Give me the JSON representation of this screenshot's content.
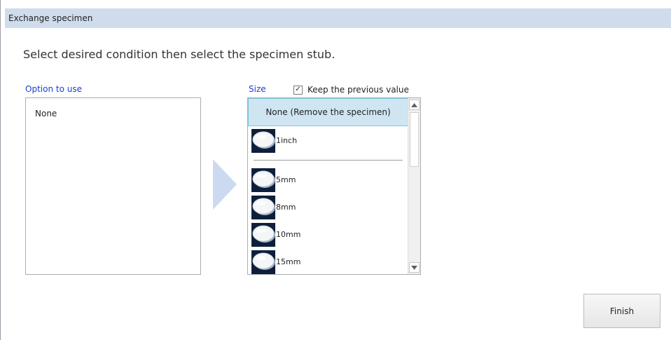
{
  "window": {
    "title": "Exchange specimen"
  },
  "instruction": "Select desired condition then select the specimen stub.",
  "option_panel": {
    "label": "Option to use",
    "items": [
      "None"
    ]
  },
  "size_panel": {
    "label": "Size",
    "keep_previous": {
      "label": "Keep the previous value",
      "checked": true,
      "check_glyph": "✓"
    },
    "selected_item": "None (Remove the specimen)",
    "items": [
      {
        "label": "1inch",
        "icon": "specimen-stub-icon"
      },
      {
        "label": "5mm",
        "icon": "specimen-stub-icon"
      },
      {
        "label": "8mm",
        "icon": "specimen-stub-icon"
      },
      {
        "label": "10mm",
        "icon": "specimen-stub-icon"
      },
      {
        "label": "15mm",
        "icon": "specimen-stub-icon"
      }
    ],
    "scroll_up_glyph": "▲",
    "scroll_down_glyph": "▼"
  },
  "footer": {
    "finish_label": "Finish"
  },
  "colors": {
    "title_bar": "#cfdcec",
    "section_label": "#1a3fd1",
    "selected_row": "#cfe6f2",
    "arrow": "#cbdaf0"
  }
}
